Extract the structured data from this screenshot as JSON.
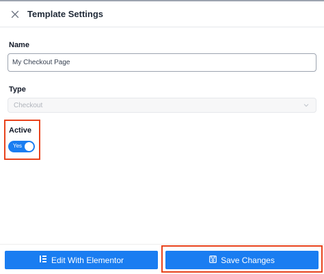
{
  "header": {
    "title": "Template Settings",
    "close_icon": "close-icon"
  },
  "form": {
    "name_label": "Name",
    "name_value": "My Checkout Page",
    "type_label": "Type",
    "type_value": "Checkout",
    "type_disabled": true,
    "active_label": "Active",
    "active_toggle_text": "Yes",
    "active_on": true
  },
  "footer": {
    "edit_button_label": "Edit With Elementor",
    "edit_button_icon": "elementor-icon",
    "save_button_label": "Save Changes",
    "save_button_icon": "save-icon"
  },
  "colors": {
    "accent": "#1a7df1",
    "highlight": "#e8421b"
  }
}
